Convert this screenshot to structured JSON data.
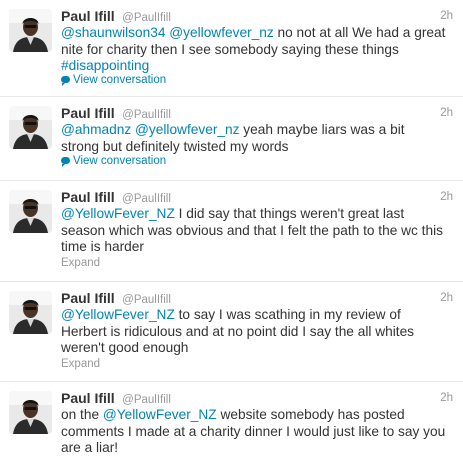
{
  "tweets": [
    {
      "name": "Paul Ifill",
      "handle": "@PaulIfill",
      "time": "2h",
      "parts": [
        {
          "t": "@shaunwilson34",
          "link": true
        },
        {
          "t": " ",
          "link": false
        },
        {
          "t": "@yellowfever_nz",
          "link": true
        },
        {
          "t": " no not at all We had a great nite for charity then I see somebody saying these things ",
          "link": false
        },
        {
          "t": "#disappointing",
          "link": true
        }
      ],
      "action": "View conversation",
      "action_type": "conversation"
    },
    {
      "name": "Paul Ifill",
      "handle": "@PaulIfill",
      "time": "2h",
      "parts": [
        {
          "t": "@ahmadnz",
          "link": true
        },
        {
          "t": " ",
          "link": false
        },
        {
          "t": "@yellowfever_nz",
          "link": true
        },
        {
          "t": " yeah maybe liars was a bit strong but definitely twisted my words",
          "link": false
        }
      ],
      "action": "View conversation",
      "action_type": "conversation"
    },
    {
      "name": "Paul Ifill",
      "handle": "@PaulIfill",
      "time": "2h",
      "parts": [
        {
          "t": "@YellowFever_NZ",
          "link": true
        },
        {
          "t": " I did say that things weren't great last season which was obvious and that I felt the path to the wc this time is harder",
          "link": false
        }
      ],
      "action": "Expand",
      "action_type": "expand"
    },
    {
      "name": "Paul Ifill",
      "handle": "@PaulIfill",
      "time": "2h",
      "parts": [
        {
          "t": "@YellowFever_NZ",
          "link": true
        },
        {
          "t": " to say I was scathing in my review of Herbert is ridiculous and at no point did I say the all whites weren't good enough",
          "link": false
        }
      ],
      "action": "Expand",
      "action_type": "expand"
    },
    {
      "name": "Paul Ifill",
      "handle": "@PaulIfill",
      "time": "2h",
      "parts": [
        {
          "t": "on the ",
          "link": false
        },
        {
          "t": "@YellowFever_NZ",
          "link": true
        },
        {
          "t": " website somebody has posted comments I made at a charity dinner I would just like to say you are a liar!",
          "link": false
        }
      ],
      "action": "",
      "action_type": "none"
    }
  ],
  "colors": {
    "link": "#0084b4",
    "muted": "#999999",
    "text": "#333333"
  },
  "icons": {
    "avatar": "user-avatar-image",
    "conversation": "speech-bubble-icon"
  }
}
